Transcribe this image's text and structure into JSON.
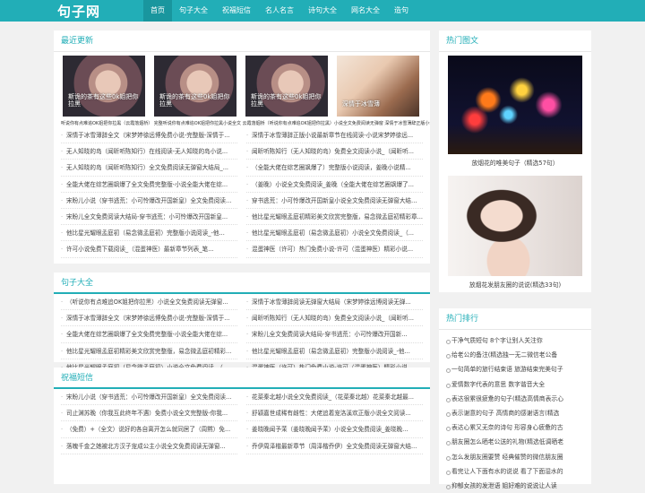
{
  "site": {
    "logo": "句子网"
  },
  "nav": [
    "首页",
    "句子大全",
    "祝福短信",
    "名人名言",
    "诗句大全",
    "网名大全",
    "造句"
  ],
  "latest": {
    "title": "最近更新",
    "thumbs": [
      {
        "watermark": "斯诡的茶有这些0k姐把你拉黑"
      },
      {
        "watermark": "斯诡的茶有这些0k姐把你拉黑"
      },
      {
        "watermark": "斯诡的茶有这些0k姐把你拉黑"
      },
      {
        "watermark": "深情于冰雪薄"
      }
    ],
    "captions": "听说你有点难追OK姐把你拉黑（云霞落烟桥） 完整听说你有点难追OK姐把你拉黑小说全文 云霞落烟桥（听说你有点难追OK姐把你拉黑）小说全文免费阅读无弹窗 深情于冰雪薄辞正版小说最新章节（宋梦婷徐远博）",
    "items": [
      "深情于冰雪薄辞全文（宋梦婷徐远博免费小说-完整版-深情于...",
      "深情于冰雪薄辞正版小说最新章节在线阅读-小说宋梦婷徐远...",
      "无人知晓的岛（闻昕听陈知行）在线阅读-无人知晓的岛小说...",
      "闻昕听陈知行（无人知晓的岛）免费全文阅读小说_（闻昕听...",
      "无人知晓的岛（闻昕听陈知行）全文免费阅读无弹窗大结局_...",
      "（全能大佬在综艺圈飒爆了）完整版小说阅读，姜晚小说精...",
      "全能大佬在综艺圈飒爆了全文免费完整版-小说全能大佬在综...",
      "（姜晚）小说全文免费阅读_姜晚（全能大佬在综艺圈飒爆了...",
      "宋盼儿小说（穿书逃荒：小可怜爆改开国新皇）全文免费阅读...",
      "穿书逃荒：小可怜爆改开国新皇小说全文免费阅读无弹窗大结局_...",
      "宋盼儿全文免费阅读大结局-穿书逃荒：小可怜爆改开国新皇...",
      "他比星光耀眼孟庭初精彩美文欣赏完整版，易念微孟庭初精彩章...",
      "他比星光耀眼孟庭初（易念微孟庭初）完整版小说阅读_-他...",
      "他比星光耀眼孟庭初（易念微孟庭初）小说全文免费阅读_（...",
      "许可小说免费下载阅读_（混蛋神医）最新章节列表_笔...",
      "混蛋神医（许可）热门免费小说-许可（混蛋神医）精彩小说..."
    ]
  },
  "juzi": {
    "title": "句子大全",
    "items": [
      "（听说你有点难追OK姐把你拉黑）小说全文免费阅读无弹窗...",
      "深情于冰雪薄辞阅读无弹窗大结局（宋梦婷徐远博阅读无弹...",
      "深情于冰雪薄辞全文（宋梦婷徐远博免费小说-完整版-深情于...",
      "闻昕听陈知行（无人知晓的岛）免费全文阅读小说_（闻昕听...",
      "全能大佬在综艺圈飒爆了全文免费完整版-小说全能大佬在综...",
      "宋盼儿全文免费阅读大结局-穿书逃荒：小可怜爆改开国新...",
      "他比星光耀眼孟庭初精彩美文欣赏完整版，易念微孟庭初精彩...",
      "他比星光耀眼孟庭初（易念微孟庭初）完整版小说阅读_-他...",
      "他比星光耀眼孟庭初（易念微孟庭初）小说全文免费阅读_（...",
      "混蛋神医（许可）热门免费小说-许可（混蛋神医）精彩小说..."
    ]
  },
  "zhufu": {
    "title": "祝福短信",
    "items": [
      "宋盼儿小说（穿书逃荒：小可怜爆改开国新皇）全文免费阅读...",
      "花菜秦北越小说全文免费阅读_（花菜秦北越）花菜秦北越最...",
      "司止渊苏晚（你我互此终年不遇）免费小说全文完整版-你我...",
      "舒颖嘉世成稀有雌性：大佬追着宠洛溪欢正版小说全文阅读...",
      "（免费）+（全文）说好的各自离开怎么就同居了（周黙）免...",
      "姜晓晚闻予茉（姜晓晚闻予茉）小说全文免费阅读_姜晓晚...",
      "落魄千金之她被北方汉子宠成公主小说全文免费阅读无弹窗...",
      "乔伊周泽楷最新章节（周泽楷乔伊）全文免费阅读无弹窗大结..."
    ]
  },
  "hot_pics": {
    "title": "热门图文",
    "items": [
      {
        "caption": "放烟花的唯美句子（精选57句）"
      },
      {
        "caption": "放烟花发朋友圈的说说(精选33句)"
      }
    ]
  },
  "hot_rank": {
    "title": "热门排行",
    "items": [
      "干净气质短句 8个字让别人关注你",
      "给老公的备注(精选独一无二微信老公备",
      "一句简单的旅行结束语 旅游结束完美句子",
      "爱情数字代表的意思 数字谐音大全",
      "表达很累很疲惫的句子(精选高情商表示心",
      "表示谢意的句子 高情商的感谢语言(精选",
      "表达心累又无奈的诗句 形容身心疲惫的古",
      "朋友圈怎么晒老公送的礼物(精选低调晒老",
      "怎么发朋友圈要赞 经典催赞的微信朋友圈",
      "看完让人下面有水的说说 看了下面湿水的",
      "抑郁女孩的发泄语 姐好难的说说让人读"
    ]
  },
  "colors": {
    "accent": "#22aeb7",
    "accent_dark": "#19969e",
    "background": "#f1f1f1"
  }
}
